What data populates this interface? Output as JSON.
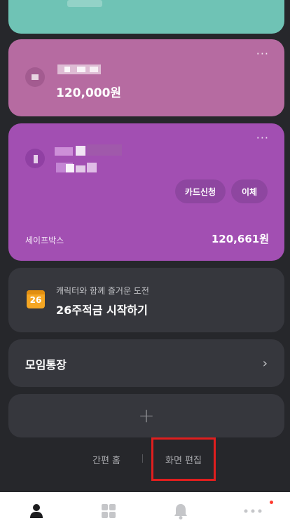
{
  "cards": {
    "second": {
      "balance": "120,000원",
      "menu_icon": "more-dots-icon"
    },
    "third": {
      "card_apply_label": "카드신청",
      "transfer_label": "이체",
      "safebox_label": "세이프박스",
      "safebox_amount": "120,661원",
      "menu_icon": "more-dots-icon"
    }
  },
  "challenge": {
    "icon_day": "26",
    "subtitle": "캐릭터와 함께 즐거운 도전",
    "title": "26주적금 시작하기"
  },
  "group_account": {
    "title": "모임통장",
    "chevron": "›"
  },
  "add_button": {
    "symbol": "+"
  },
  "footer_links": {
    "simple_home": "간편 홈",
    "edit_screen": "화면 편집"
  },
  "tabbar": {
    "items": [
      "person-icon",
      "grid-icon",
      "bell-icon",
      "more-icon"
    ],
    "colors": {
      "active": "#1c1c1e",
      "inactive": "#c5c6c9",
      "badge": "#ff3b30"
    }
  }
}
